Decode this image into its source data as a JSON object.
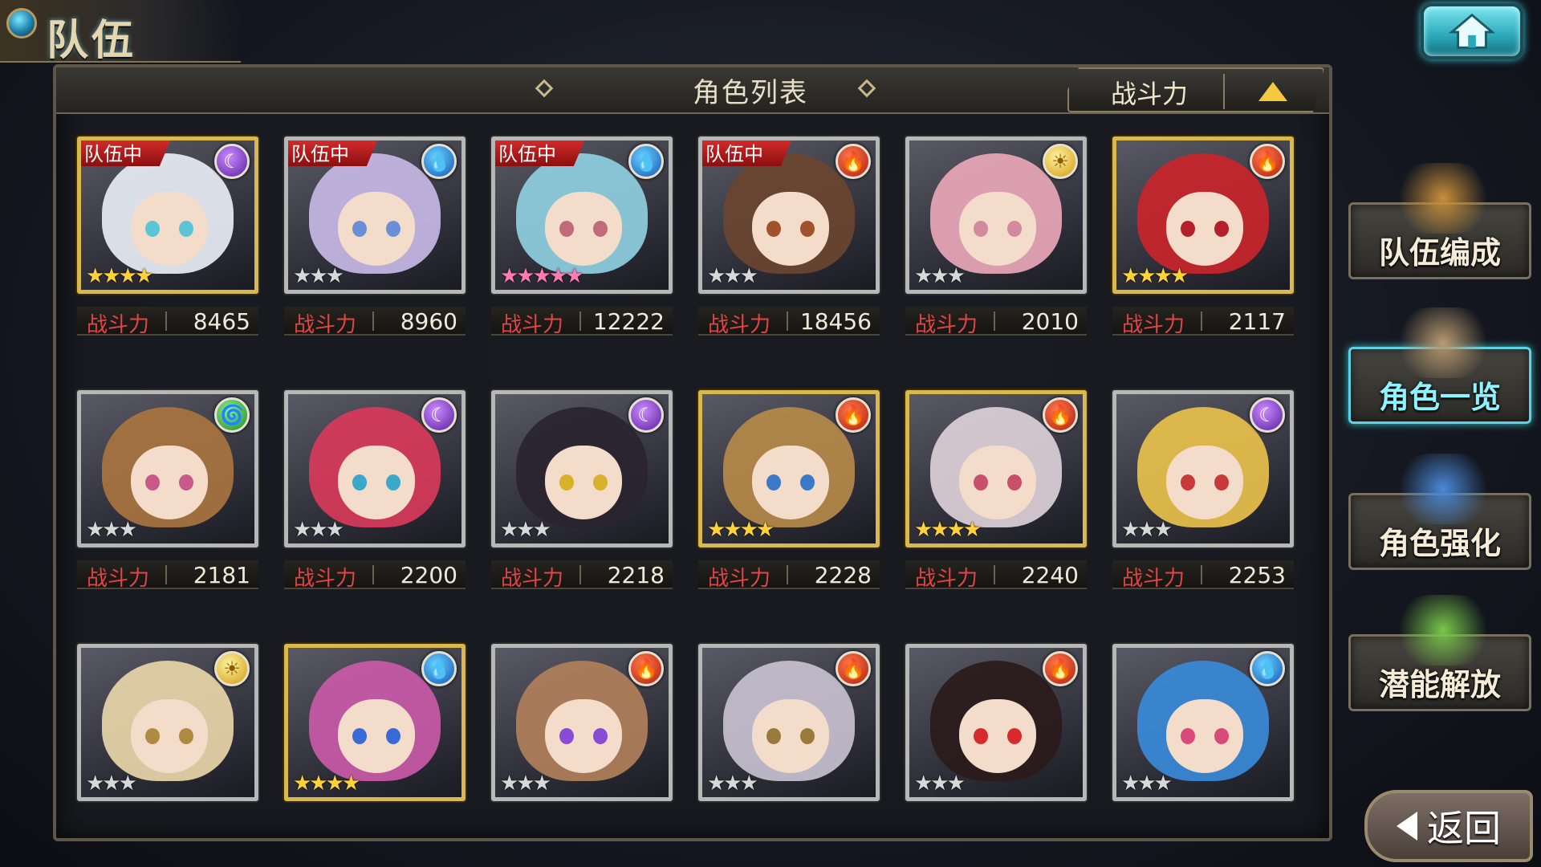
{
  "header": {
    "screen_title": "队伍",
    "list_title": "角色列表",
    "sort_label": "战斗力"
  },
  "power_label": "战斗力",
  "characters": [
    {
      "in_team": true,
      "element": "dark",
      "stars": 4,
      "frame": "gold",
      "power": "8465",
      "hair": "#e8eef5",
      "eye": "#5bc4d6"
    },
    {
      "in_team": true,
      "element": "water",
      "stars": 3,
      "frame": "silver",
      "power": "8960",
      "hair": "#c7b8e6",
      "eye": "#6a8fd8"
    },
    {
      "in_team": true,
      "element": "water",
      "stars": 5,
      "frame": "silver",
      "power": "12222",
      "hair": "#8ecfe0",
      "eye": "#c06a7a"
    },
    {
      "in_team": true,
      "element": "fire",
      "stars": 3,
      "frame": "silver",
      "power": "18456",
      "hair": "#6a4530",
      "eye": "#a0522d"
    },
    {
      "in_team": false,
      "element": "light",
      "stars": 3,
      "frame": "silver",
      "power": "2010",
      "hair": "#e8a7b8",
      "eye": "#d28aa0"
    },
    {
      "in_team": false,
      "element": "fire",
      "stars": 4,
      "frame": "gold",
      "power": "2117",
      "hair": "#c8252a",
      "eye": "#b3202a"
    },
    {
      "in_team": false,
      "element": "wind",
      "stars": 3,
      "frame": "silver",
      "power": "2181",
      "hair": "#a9743f",
      "eye": "#c85a8a"
    },
    {
      "in_team": false,
      "element": "dark",
      "stars": 3,
      "frame": "silver",
      "power": "2200",
      "hair": "#d8395a",
      "eye": "#3aa8c8"
    },
    {
      "in_team": false,
      "element": "dark",
      "stars": 3,
      "frame": "silver",
      "power": "2218",
      "hair": "#2a2430",
      "eye": "#d8b02a"
    },
    {
      "in_team": false,
      "element": "fire",
      "stars": 4,
      "frame": "gold",
      "power": "2228",
      "hair": "#b58a4a",
      "eye": "#3a78c8"
    },
    {
      "in_team": false,
      "element": "fire",
      "stars": 4,
      "frame": "gold",
      "power": "2240",
      "hair": "#dcd0d8",
      "eye": "#c8506a"
    },
    {
      "in_team": false,
      "element": "dark",
      "stars": 3,
      "frame": "silver",
      "power": "2253",
      "hair": "#e8c04a",
      "eye": "#c83a3a"
    },
    {
      "in_team": false,
      "element": "light",
      "stars": 3,
      "frame": "silver",
      "power": "",
      "hair": "#e8d6a8",
      "eye": "#b08a40"
    },
    {
      "in_team": false,
      "element": "water",
      "stars": 4,
      "frame": "gold",
      "power": "",
      "hair": "#c85aa8",
      "eye": "#3a6ad8"
    },
    {
      "in_team": false,
      "element": "fire",
      "stars": 3,
      "frame": "silver",
      "power": "",
      "hair": "#b0805a",
      "eye": "#8a4ad8"
    },
    {
      "in_team": false,
      "element": "fire",
      "stars": 3,
      "frame": "silver",
      "power": "",
      "hair": "#c8c0d0",
      "eye": "#9a7a3a"
    },
    {
      "in_team": false,
      "element": "fire",
      "stars": 3,
      "frame": "silver",
      "power": "",
      "hair": "#2a1a1a",
      "eye": "#d82a2a"
    },
    {
      "in_team": false,
      "element": "water",
      "stars": 3,
      "frame": "silver",
      "power": "",
      "hair": "#3a8ad8",
      "eye": "#d84a7a"
    }
  ],
  "team_badge_label": "队伍中",
  "menu": [
    {
      "label": "队伍编成",
      "active": false,
      "art_color": "#c8903a"
    },
    {
      "label": "角色一览",
      "active": true,
      "art_color": "#b89a70"
    },
    {
      "label": "角色强化",
      "active": false,
      "art_color": "#4a8ad8"
    },
    {
      "label": "潜能解放",
      "active": false,
      "art_color": "#7ac84a"
    }
  ],
  "back_label": "返回",
  "element_glyphs": {
    "fire": "🔥",
    "water": "💧",
    "dark": "☾",
    "light": "☀",
    "wind": "🌀"
  },
  "colors": {
    "team_badge": "#c41f1f",
    "power_label": "#e24545",
    "active_menu": "#5fd1e6",
    "sort_arrow": "#f5c842"
  }
}
